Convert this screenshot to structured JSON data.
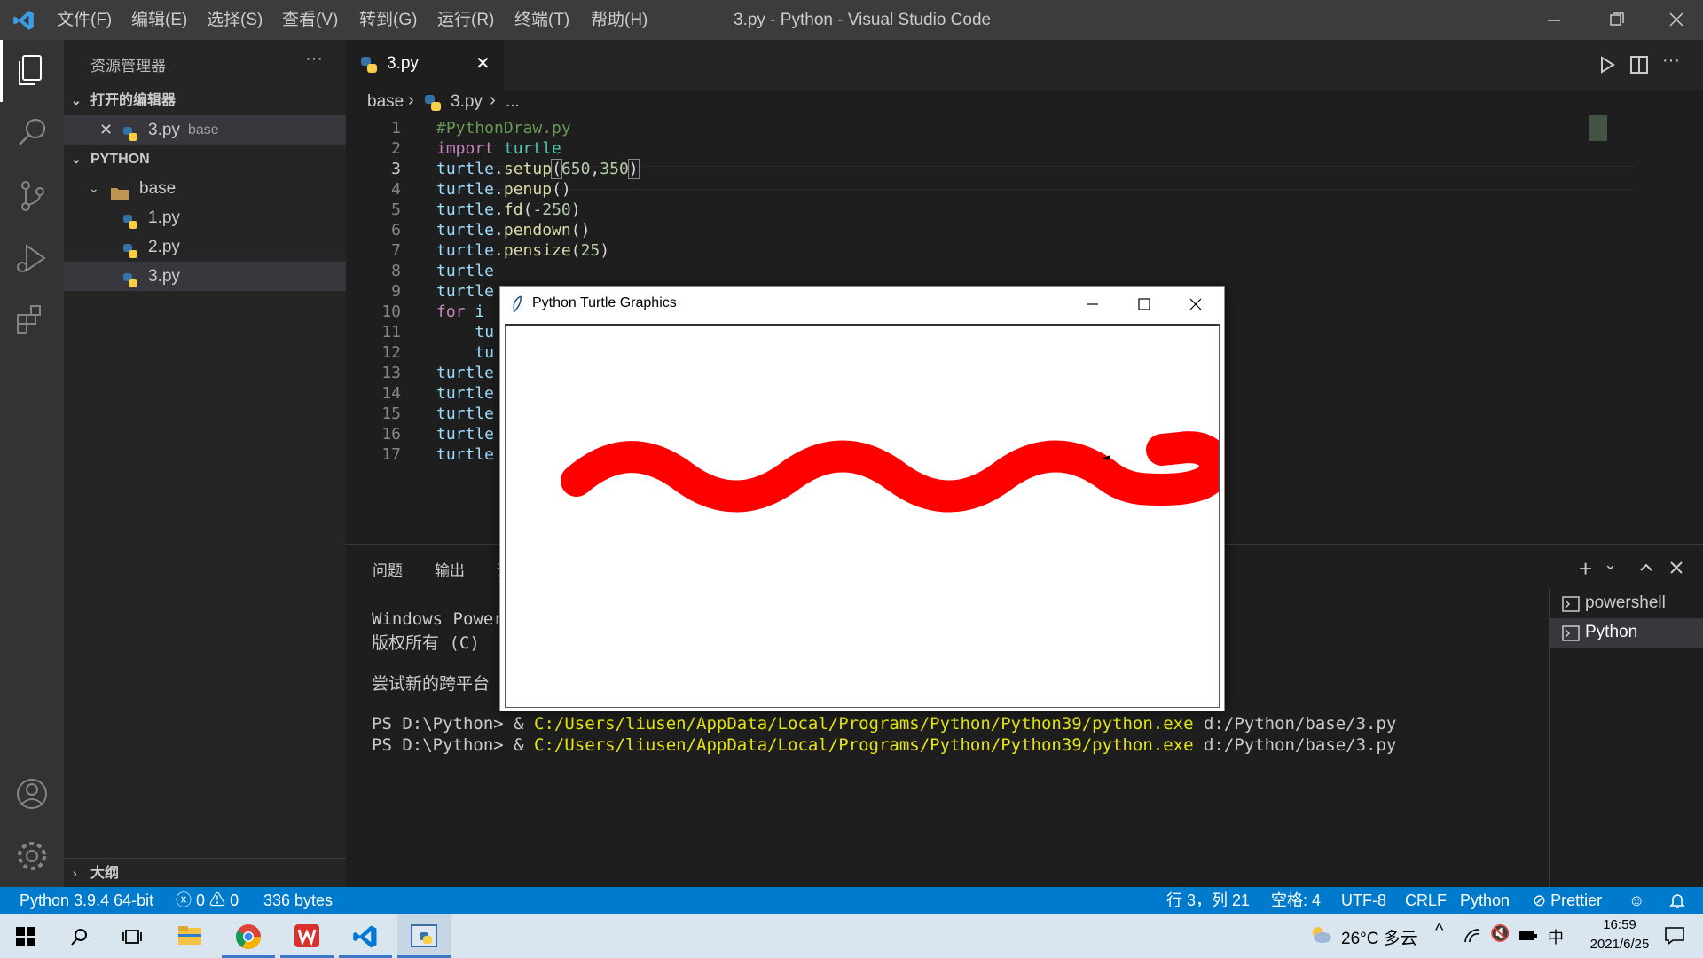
{
  "titlebar": {
    "menu": [
      "文件(F)",
      "编辑(E)",
      "选择(S)",
      "查看(V)",
      "转到(G)",
      "运行(R)",
      "终端(T)",
      "帮助(H)"
    ],
    "window_title": "3.py - Python - Visual Studio Code"
  },
  "sidebar": {
    "title": "资源管理器",
    "more": "···",
    "open_editors_label": "打开的编辑器",
    "open_editor_item": {
      "name": "3.py",
      "folder": "base"
    },
    "workspace_label": "PYTHON",
    "folder": "base",
    "files": [
      "1.py",
      "2.py",
      "3.py"
    ],
    "outline_label": "大纲"
  },
  "editor": {
    "tab_label": "3.py",
    "breadcrumb": [
      "base",
      "3.py",
      "..."
    ],
    "line_numbers": [
      "1",
      "2",
      "3",
      "4",
      "5",
      "6",
      "7",
      "8",
      "9",
      "10",
      "11",
      "12",
      "13",
      "14",
      "15",
      "16",
      "17"
    ],
    "current_line": 3
  },
  "panel": {
    "tabs": [
      "问题",
      "输出",
      "调"
    ],
    "terminal_lines": [
      "Windows Power",
      "版权所有 (C) ",
      "",
      "尝试新的跨平台"
    ],
    "ps_prompt": "PS D:\\Python> & ",
    "ps_cmd": "C:/Users/liusen/AppData/Local/Programs/Python/Python39/python.exe",
    "ps_arg": " d:/Python/base/3.py",
    "terminals": [
      "powershell",
      "Python"
    ]
  },
  "turtle_window": {
    "title": "Python Turtle Graphics"
  },
  "statusbar": {
    "interpreter": "Python 3.9.4 64-bit",
    "errors": "0",
    "warnings": "0",
    "size": "336 bytes",
    "position": "行 3，列 21",
    "spaces": "空格: 4",
    "encoding": "UTF-8",
    "eol": "CRLF",
    "language": "Python",
    "formatter": "Prettier"
  },
  "taskbar": {
    "weather": "26°C 多云",
    "ime": "中",
    "time": "16:59",
    "date": "2021/6/25"
  },
  "colors": {
    "accent": "#007acc",
    "snake": "#ff0000"
  }
}
